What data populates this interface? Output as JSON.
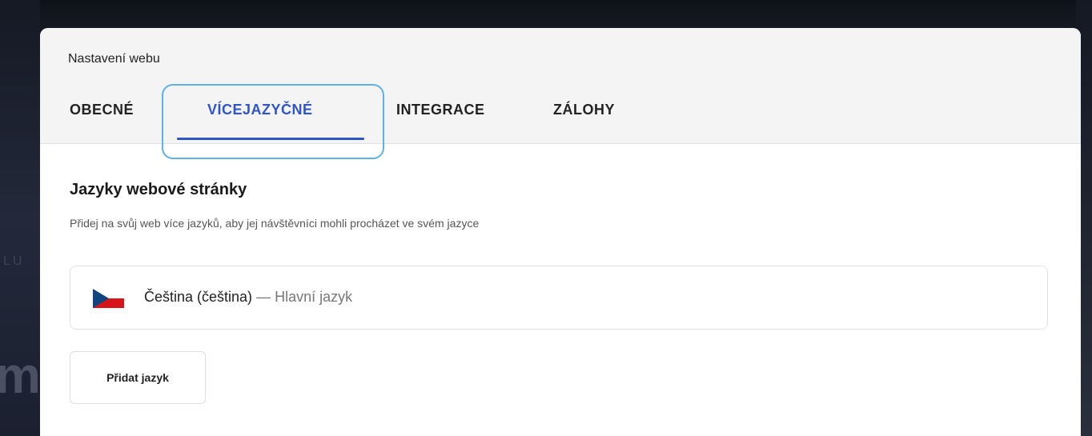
{
  "modal": {
    "title": "Nastavení webu"
  },
  "tabs": [
    {
      "label": "OBECNÉ",
      "active": false
    },
    {
      "label": "VÍCEJAZYČNÉ",
      "active": true
    },
    {
      "label": "INTEGRACE",
      "active": false
    },
    {
      "label": "ZÁLOHY",
      "active": false
    }
  ],
  "background": {
    "text_left": "LU",
    "text_big": "m"
  },
  "languages_section": {
    "title": "Jazyky webové stránky",
    "subtitle": "Přidej na svůj web více jazyků, aby jej návštěvníci mohli procházet ve svém jazyce",
    "languages": [
      {
        "flag_icon": "czech-flag-icon",
        "name": "Čeština (čeština)",
        "separator": "—",
        "note": "Hlavní jazyk"
      }
    ],
    "add_button_label": "Přidat jazyk"
  },
  "colors": {
    "accent": "#2f55c8",
    "highlight": "#5fb2e6",
    "flag_white": "#ffffff",
    "flag_red": "#d7141a",
    "flag_blue": "#11457e"
  }
}
